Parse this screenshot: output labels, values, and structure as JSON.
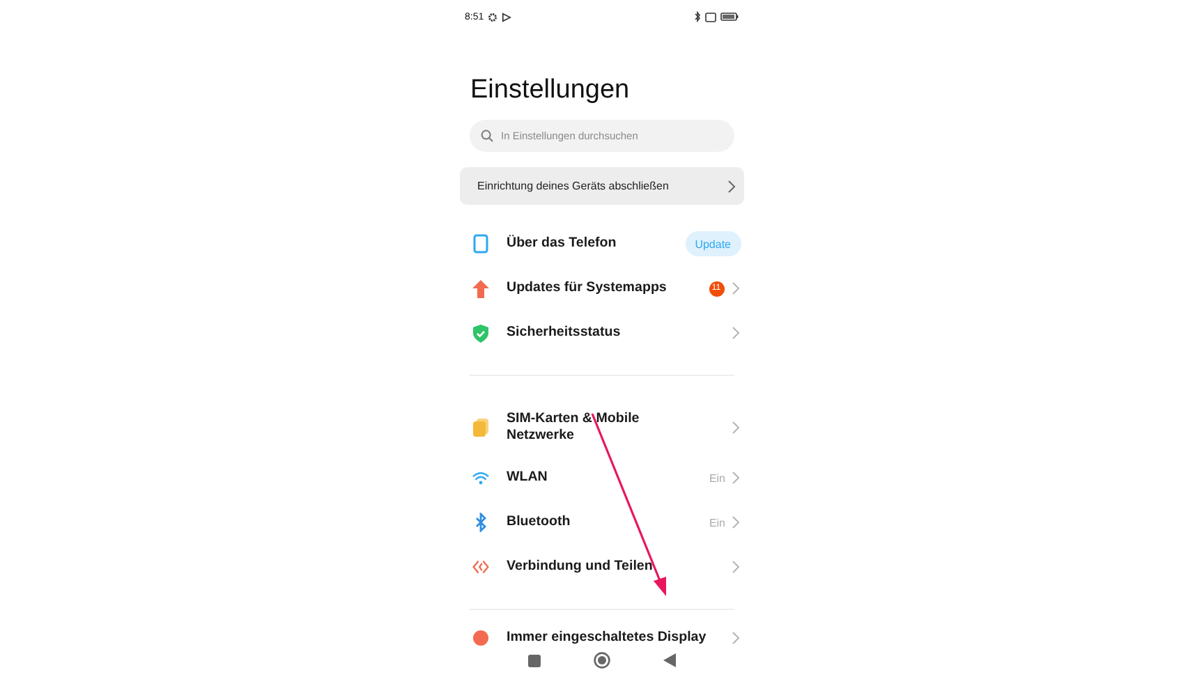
{
  "status_bar": {
    "time": "8:51"
  },
  "title": "Einstellungen",
  "search": {
    "placeholder": "In Einstellungen durchsuchen"
  },
  "setup_card": {
    "label": "Einrichtung deines Geräts abschließen"
  },
  "sections": [
    [
      {
        "label": "Über das Telefon",
        "button": "Update"
      },
      {
        "label": "Updates für Systemapps",
        "badge": "11"
      },
      {
        "label": "Sicherheitsstatus"
      }
    ],
    [
      {
        "label": "SIM-Karten & Mobile Netzwerke"
      },
      {
        "label": "WLAN",
        "value": "Ein"
      },
      {
        "label": "Bluetooth",
        "value": "Ein"
      },
      {
        "label": "Verbindung und Teilen"
      }
    ],
    [
      {
        "label": "Immer eingeschaltetes Display"
      }
    ]
  ]
}
